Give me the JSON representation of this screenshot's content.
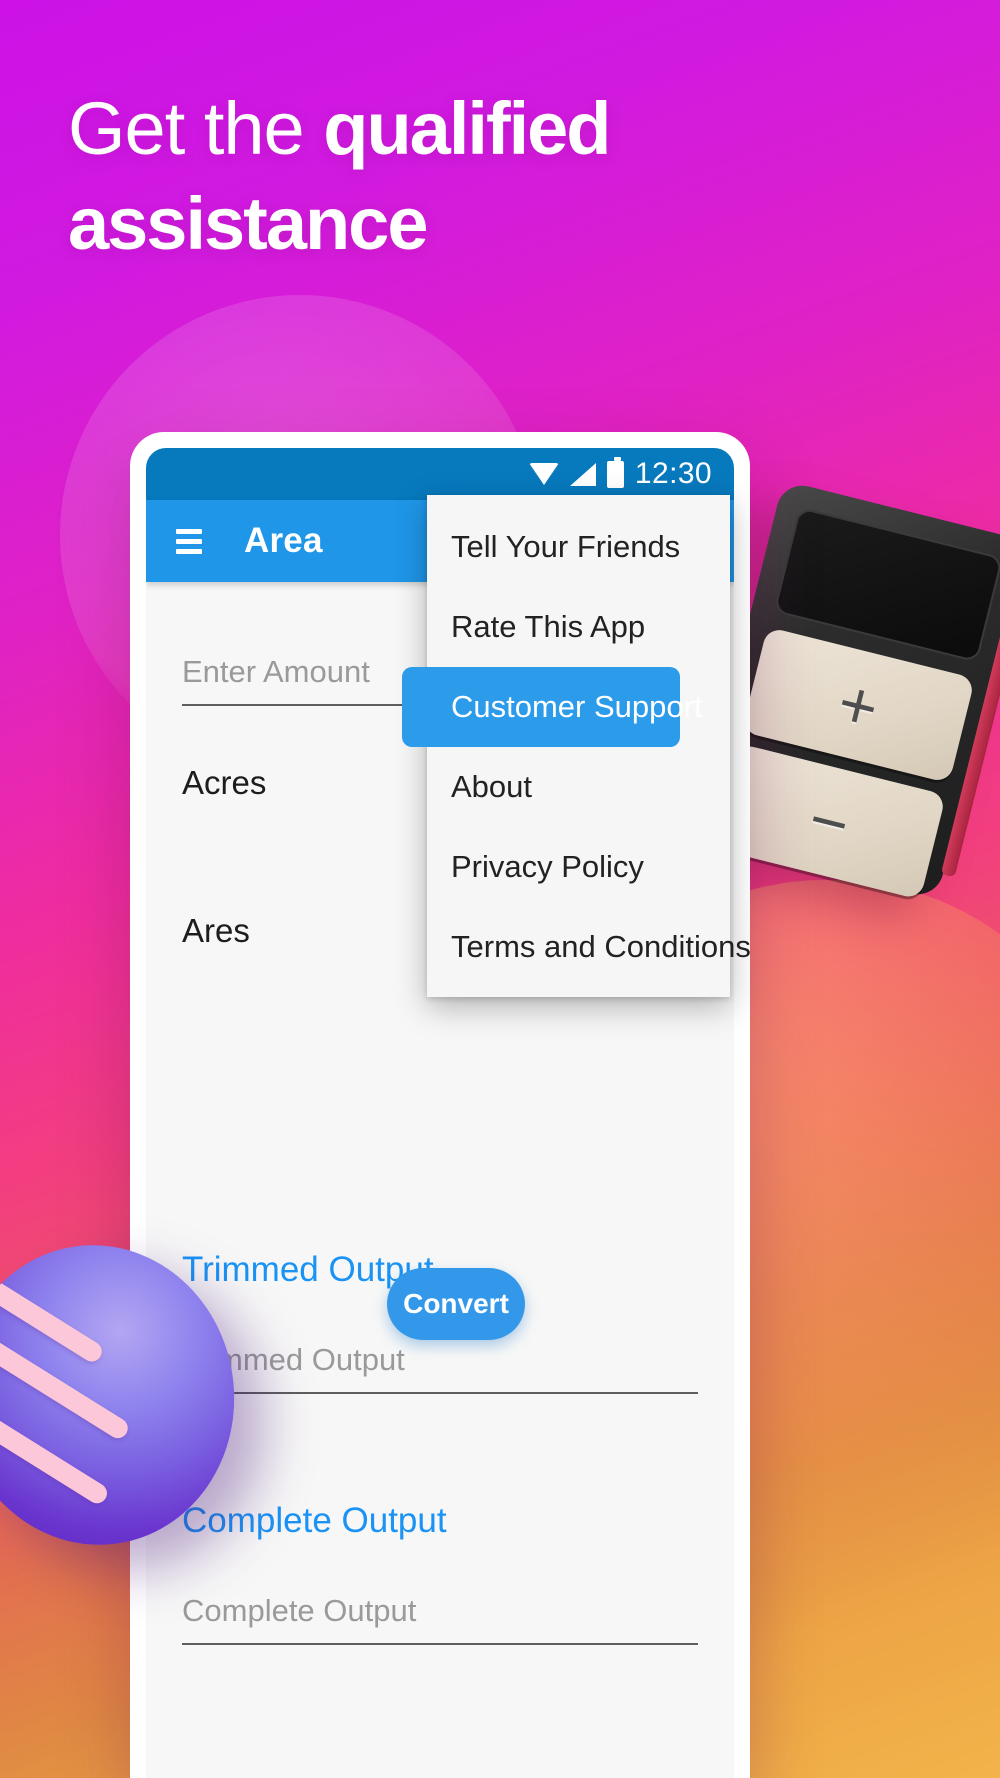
{
  "promo": {
    "headline_normal": "Get the ",
    "headline_bold": "qualified assistance"
  },
  "phone": {
    "status_bar": {
      "time": "12:30",
      "icons": [
        "wifi-icon",
        "signal-icon",
        "battery-icon"
      ]
    },
    "app_bar": {
      "menu_icon": "hamburger-menu-icon",
      "title": "Area"
    },
    "form": {
      "amount_placeholder": "Enter Amount",
      "unit_from": "Acres",
      "unit_to": "Ares",
      "convert_label": "Convert",
      "trimmed_output_label": "Trimmed Output",
      "trimmed_output_placeholder": "Trimmed Output",
      "complete_output_label": "Complete Output",
      "complete_output_placeholder": "Complete Output"
    },
    "overflow_menu": {
      "items": [
        {
          "label": "Tell Your Friends",
          "selected": false
        },
        {
          "label": "Rate This App",
          "selected": false
        },
        {
          "label": "Customer Support",
          "selected": true
        },
        {
          "label": "About",
          "selected": false
        },
        {
          "label": "Privacy Policy",
          "selected": false
        },
        {
          "label": "Terms and Conditions",
          "selected": false
        }
      ]
    }
  },
  "props": {
    "calculator": {
      "plus_key": "+",
      "minus_key": "−"
    }
  },
  "colors": {
    "status_bar": "#0779bd",
    "app_bar": "#1f96e8",
    "accent_blue": "#1a93f5",
    "menu_highlight": "#2c9bea",
    "bg_start": "#cc12e6",
    "bg_end": "#f2b44a"
  }
}
